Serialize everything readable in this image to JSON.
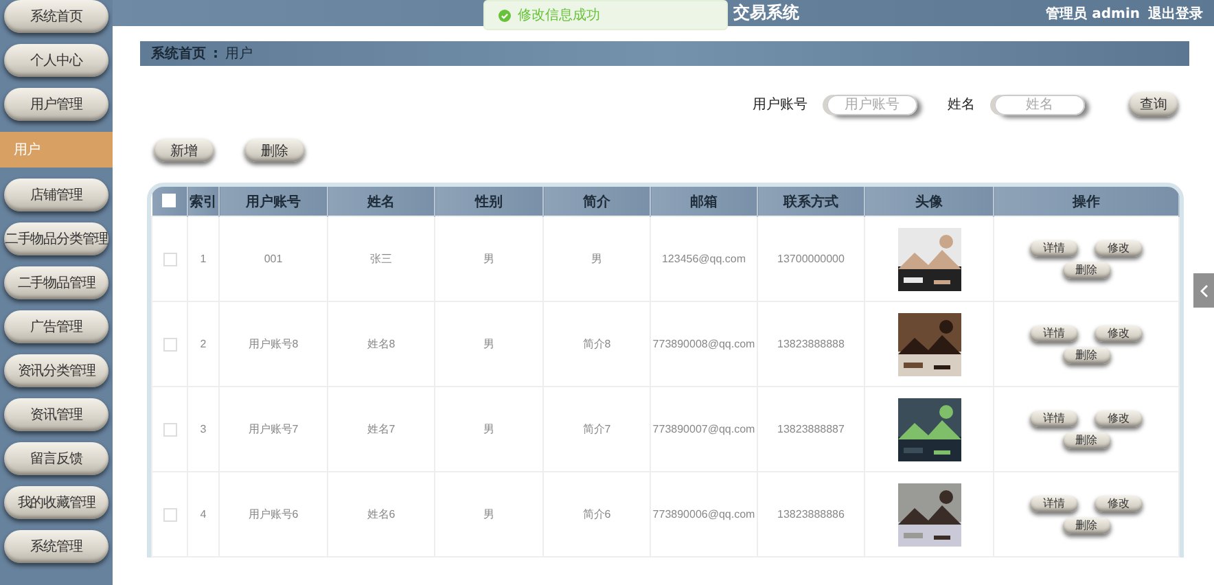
{
  "sidebar": {
    "items": [
      {
        "label": "系统首页",
        "selected": false
      },
      {
        "label": "个人中心",
        "selected": false
      },
      {
        "label": "用户管理",
        "selected": false
      },
      {
        "label": "用户",
        "selected": true
      },
      {
        "label": "店铺管理",
        "selected": false
      },
      {
        "label": "二手物品分类管理",
        "selected": false
      },
      {
        "label": "二手物品管理",
        "selected": false
      },
      {
        "label": "广告管理",
        "selected": false
      },
      {
        "label": "资讯分类管理",
        "selected": false
      },
      {
        "label": "资讯管理",
        "selected": false
      },
      {
        "label": "留言反馈",
        "selected": false
      },
      {
        "label": "我的收藏管理",
        "selected": false
      },
      {
        "label": "系统管理",
        "selected": false
      }
    ]
  },
  "header": {
    "title": "交易系统",
    "user": "管理员 admin",
    "logout": "退出登录"
  },
  "toast": {
    "message": "修改信息成功"
  },
  "breadcrumb": {
    "items": [
      "系统首页",
      "用户"
    ],
    "separator": ":"
  },
  "search": {
    "fields": [
      {
        "label": "用户账号",
        "placeholder": "用户账号"
      },
      {
        "label": "姓名",
        "placeholder": "姓名"
      }
    ],
    "button": "查询"
  },
  "actions": [
    "新增",
    "删除"
  ],
  "table": {
    "select_all_checked": false,
    "columns": [
      "索引",
      "用户账号",
      "姓名",
      "性别",
      "简介",
      "邮箱",
      "联系方式",
      "头像",
      "操作"
    ],
    "rows": [
      {
        "checked": false,
        "cells": [
          "1",
          "001",
          "张三",
          "男",
          "男",
          "123456@qq.com",
          "13700000000"
        ],
        "avatar": {
          "kind": "picture"
        },
        "buttons": [
          "详情",
          "修改",
          "删除"
        ]
      },
      {
        "checked": false,
        "cells": [
          "2",
          "用户账号8",
          "姓名8",
          "男",
          "简介8",
          "773890008@qq.com",
          "13823888888"
        ],
        "avatar": {
          "kind": "picture"
        },
        "buttons": [
          "详情",
          "修改",
          "删除"
        ]
      },
      {
        "checked": false,
        "cells": [
          "3",
          "用户账号7",
          "姓名7",
          "男",
          "简介7",
          "773890007@qq.com",
          "13823888887"
        ],
        "avatar": {
          "kind": "picture"
        },
        "buttons": [
          "详情",
          "修改",
          "删除"
        ]
      },
      {
        "checked": false,
        "cells": [
          "4",
          "用户账号6",
          "姓名6",
          "男",
          "简介6",
          "773890006@qq.com",
          "13823888886"
        ],
        "avatar": {
          "kind": "picture"
        },
        "buttons": [
          "详情",
          "修改",
          "删除"
        ]
      }
    ]
  }
}
